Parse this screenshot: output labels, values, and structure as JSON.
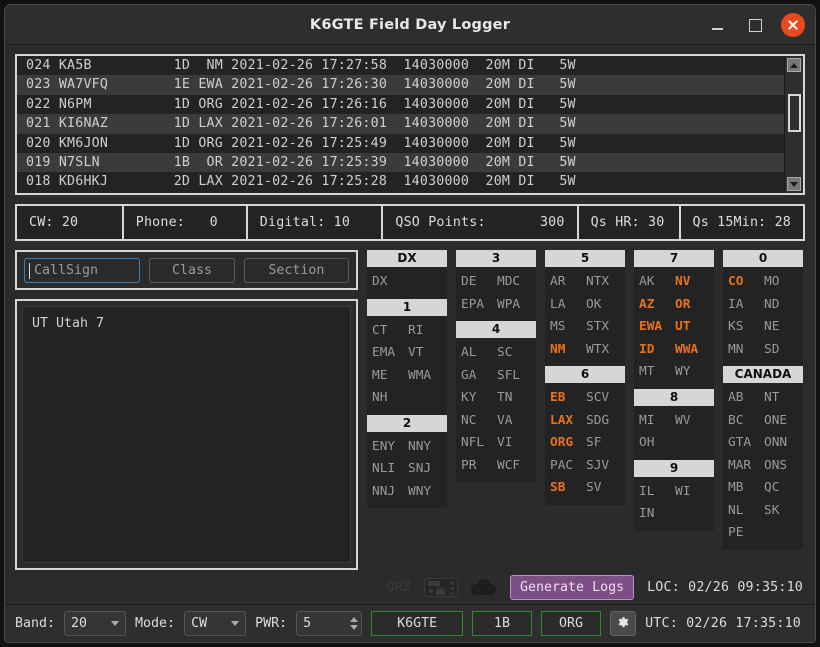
{
  "window": {
    "title": "K6GTE Field Day Logger",
    "minimize_label": "–",
    "maximize_label": "☐",
    "close_label": "✕"
  },
  "log": {
    "rows": [
      "024 KA5B          1D  NM 2021-02-26 17:27:58  14030000  20M DI   5W",
      "023 WA7VFQ        1E EWA 2021-02-26 17:26:30  14030000  20M DI   5W",
      "022 N6PM          1D ORG 2021-02-26 17:26:16  14030000  20M DI   5W",
      "021 KI6NAZ        1D LAX 2021-02-26 17:26:01  14030000  20M DI   5W",
      "020 KM6JON        1D ORG 2021-02-26 17:25:49  14030000  20M DI   5W",
      "019 N7SLN         1B  OR 2021-02-26 17:25:39  14030000  20M DI   5W",
      "018 KD6HKJ        2D LAX 2021-02-26 17:25:28  14030000  20M DI   5W"
    ]
  },
  "stats": {
    "cw": "CW: 20",
    "phone": "Phone:   0",
    "digital": "Digital: 10",
    "points_label": "QSO Points:",
    "points_value": "300",
    "qs_hr": "Qs HR: 30",
    "qs_15min": "Qs 15Min: 28"
  },
  "entry": {
    "callsign_placeholder": "CallSign",
    "callsign_value": "",
    "class_placeholder": "Class",
    "class_value": "",
    "section_placeholder": "Section",
    "section_value": "",
    "info_text": "UT Utah 7"
  },
  "sections": {
    "worked": [
      "NM",
      "EB",
      "LAX",
      "ORG",
      "SB",
      "AZ",
      "EWA",
      "ID",
      "NV",
      "OR",
      "UT",
      "WWA",
      "CO"
    ],
    "columns": [
      {
        "groups": [
          {
            "header": "DX",
            "cells": [
              "DX",
              ""
            ]
          },
          {
            "header": "1",
            "cells": [
              "CT",
              "RI",
              "EMA",
              "VT",
              "ME",
              "WMA",
              "NH",
              ""
            ]
          },
          {
            "header": "2",
            "cells": [
              "ENY",
              "NNY",
              "NLI",
              "SNJ",
              "NNJ",
              "WNY"
            ]
          }
        ]
      },
      {
        "groups": [
          {
            "header": "3",
            "cells": [
              "DE",
              "MDC",
              "EPA",
              "WPA"
            ]
          },
          {
            "header": "4",
            "cells": [
              "AL",
              "SC",
              "GA",
              "SFL",
              "KY",
              "TN",
              "NC",
              "VA",
              "NFL",
              "VI",
              "PR",
              "WCF"
            ]
          }
        ]
      },
      {
        "groups": [
          {
            "header": "5",
            "cells": [
              "AR",
              "NTX",
              "LA",
              "OK",
              "MS",
              "STX",
              "NM",
              "WTX"
            ]
          },
          {
            "header": "6",
            "cells": [
              "EB",
              "SCV",
              "LAX",
              "SDG",
              "ORG",
              "SF",
              "PAC",
              "SJV",
              "SB",
              "SV"
            ]
          }
        ]
      },
      {
        "groups": [
          {
            "header": "7",
            "cells": [
              "AK",
              "NV",
              "AZ",
              "OR",
              "EWA",
              "UT",
              "ID",
              "WWA",
              "MT",
              "WY"
            ]
          },
          {
            "header": "8",
            "cells": [
              "MI",
              "WV",
              "OH",
              ""
            ]
          },
          {
            "header": "9",
            "cells": [
              "IL",
              "WI",
              "IN",
              ""
            ]
          }
        ]
      },
      {
        "groups": [
          {
            "header": "0",
            "cells": [
              "CO",
              "MO",
              "IA",
              "ND",
              "KS",
              "NE",
              "MN",
              "SD"
            ]
          },
          {
            "header": "CANADA",
            "cells": [
              "AB",
              "NT",
              "BC",
              "ONE",
              "GTA",
              "ONN",
              "MAR",
              "ONS",
              "MB",
              "QC",
              "NL",
              "SK",
              "PE",
              ""
            ]
          }
        ]
      }
    ]
  },
  "toolbar": {
    "qrz_label": "QRZ",
    "radio_icon": "radio-icon",
    "cloud_icon": "cloud-icon",
    "generate_logs_label": "Generate Logs",
    "local_time": "LOC: 02/26 09:35:10"
  },
  "statusbar": {
    "band_label": "Band:",
    "band_value": "20",
    "mode_label": "Mode:",
    "mode_value": "CW",
    "pwr_label": "PWR:",
    "pwr_value": "5",
    "my_call": "K6GTE",
    "my_class": "1B",
    "my_section": "ORG",
    "settings_icon": "gear-icon",
    "utc_time": "UTC: 02/26 17:35:10"
  },
  "colors": {
    "worked_accent": "#e8721c",
    "green_border": "#2f8a2f",
    "purple_button": "#7d4f86",
    "focus_border": "#3d7fb5"
  }
}
